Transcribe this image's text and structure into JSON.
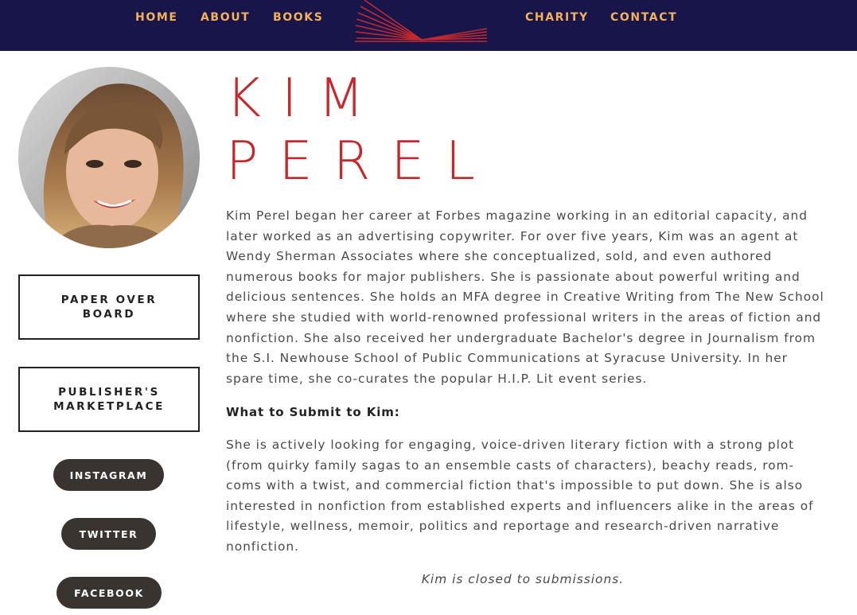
{
  "nav": {
    "home": "HOME",
    "about": "ABOUT",
    "books": "BOOKS",
    "charity": "CHARITY",
    "contact": "CONTACT"
  },
  "logo_icon": "open-book-logo-icon",
  "profile": {
    "photo_icon": "profile-photo",
    "first_name": "KIM",
    "last_name": "PEREL"
  },
  "sidebar": {
    "links": [
      {
        "label": "PAPER OVER BOARD"
      },
      {
        "label": "PUBLISHER'S MARKETPLACE"
      }
    ],
    "social": [
      {
        "label": "INSTAGRAM"
      },
      {
        "label": "TWITTER"
      },
      {
        "label": "FACEBOOK"
      }
    ]
  },
  "bio": "Kim Perel began her career at Forbes magazine working in an editorial capacity, and later worked as an advertising copywriter. For over five years, Kim was an agent at Wendy Sherman Associates where she conceptualized, sold, and even authored numerous books for major publishers. She is passionate about powerful writing and delicious sentences. She holds an MFA degree in Creative Writing from The New School where she studied with world-renowned professional writers in the areas of fiction and nonfiction. She also received her undergraduate Bachelor's degree in Journalism from the S.I. Newhouse School of Public Communications at Syracuse University. In her spare time, she co-curates the popular H.I.P. Lit event series.",
  "submit_heading": "What to Submit to Kim:",
  "submit_text": "She is actively looking for engaging, voice-driven literary fiction with a strong plot (from quirky family sagas to an ensemble casts of characters), beachy reads, rom-coms with a twist, and commercial fiction that's impossible to put down. She is also interested in nonfiction from established experts and influencers alike in the areas of lifestyle, wellness, memoir, politics and reportage and research-driven narrative nonfiction.",
  "status": "Kim is closed to submissions.",
  "colors": {
    "nav_background": "#18154a",
    "nav_link": "#f4b15a",
    "name": "#c4282c",
    "pill": "#3a3431",
    "text": "#4a4a4a"
  }
}
